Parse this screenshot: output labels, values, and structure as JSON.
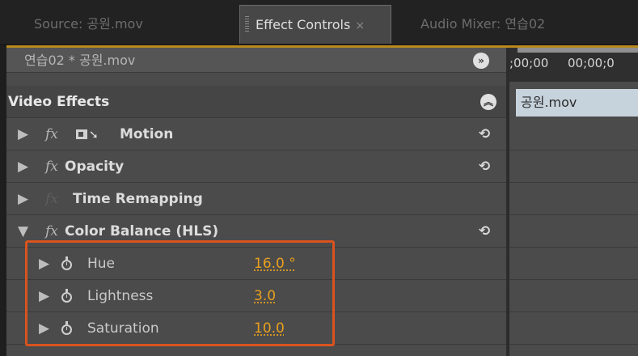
{
  "tabs": [
    {
      "label": "Source: 공원.mov",
      "active": false
    },
    {
      "label": "Effect Controls",
      "active": true,
      "close": "×"
    },
    {
      "label": "Audio Mixer: 연습02",
      "active": false
    }
  ],
  "clip_title": "연습02 * 공원.mov",
  "video_effects_label": "Video Effects",
  "effects": [
    {
      "label": "Motion",
      "fx": "fx"
    },
    {
      "label": "Opacity",
      "fx": "fx"
    },
    {
      "label": "Time Remapping",
      "fx": "fx"
    },
    {
      "label": "Color Balance (HLS)",
      "fx": "fx"
    }
  ],
  "properties": [
    {
      "label": "Hue",
      "value": "16.0 °"
    },
    {
      "label": "Lightness",
      "value": "3.0"
    },
    {
      "label": "Saturation",
      "value": "10.0"
    }
  ],
  "timeline": {
    "timecodes": [
      ";00;00",
      "00;00;0"
    ],
    "clip_label": "공원.mov"
  },
  "icons": {
    "collapse_expand": "chevron-right-double-icon",
    "collapse_up": "chevron-up-double-icon",
    "reset": "reset-icon",
    "stopwatch": "stopwatch-icon",
    "motion": "motion-icon"
  },
  "colors": {
    "value": "#e8a01e",
    "highlight_box": "#d9531e",
    "panel_bg": "#4b4b4b",
    "clip_bar": "#c7d3dc"
  }
}
